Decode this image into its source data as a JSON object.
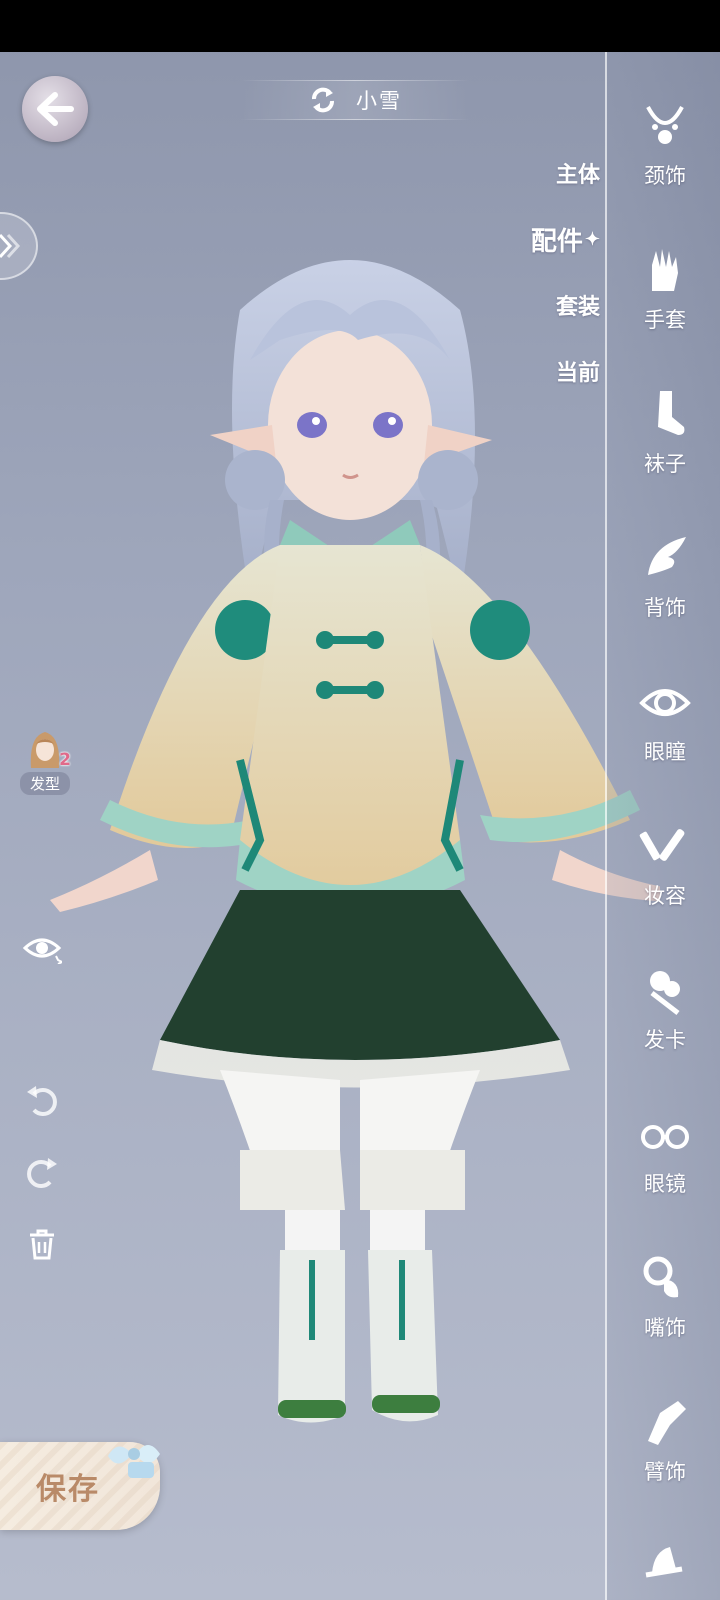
{
  "title": {
    "name": "小雪"
  },
  "category_tabs": [
    {
      "label": "主体",
      "active": false
    },
    {
      "label": "配件",
      "active": true,
      "marker": "✦"
    },
    {
      "label": "套装",
      "active": false
    },
    {
      "label": "当前",
      "active": false
    }
  ],
  "accessories": [
    {
      "label": "颈饰",
      "icon": "necklace-icon"
    },
    {
      "label": "手套",
      "icon": "glove-icon"
    },
    {
      "label": "袜子",
      "icon": "sock-icon"
    },
    {
      "label": "背饰",
      "icon": "wing-icon"
    },
    {
      "label": "眼瞳",
      "icon": "eye-icon"
    },
    {
      "label": "妆容",
      "icon": "makeup-icon"
    },
    {
      "label": "发卡",
      "icon": "hairclip-icon"
    },
    {
      "label": "眼镜",
      "icon": "glasses-icon"
    },
    {
      "label": "嘴饰",
      "icon": "pacifier-icon"
    },
    {
      "label": "臂饰",
      "icon": "armband-icon"
    },
    {
      "label": "",
      "icon": "hat-icon"
    }
  ],
  "left_tools": {
    "hair_label": "发型",
    "hair_count": "2"
  },
  "save": {
    "label": "保存"
  },
  "colors": {
    "background": "#9ea6bb",
    "save_text": "#b98a68",
    "hair_badge": "#e06a8a"
  }
}
